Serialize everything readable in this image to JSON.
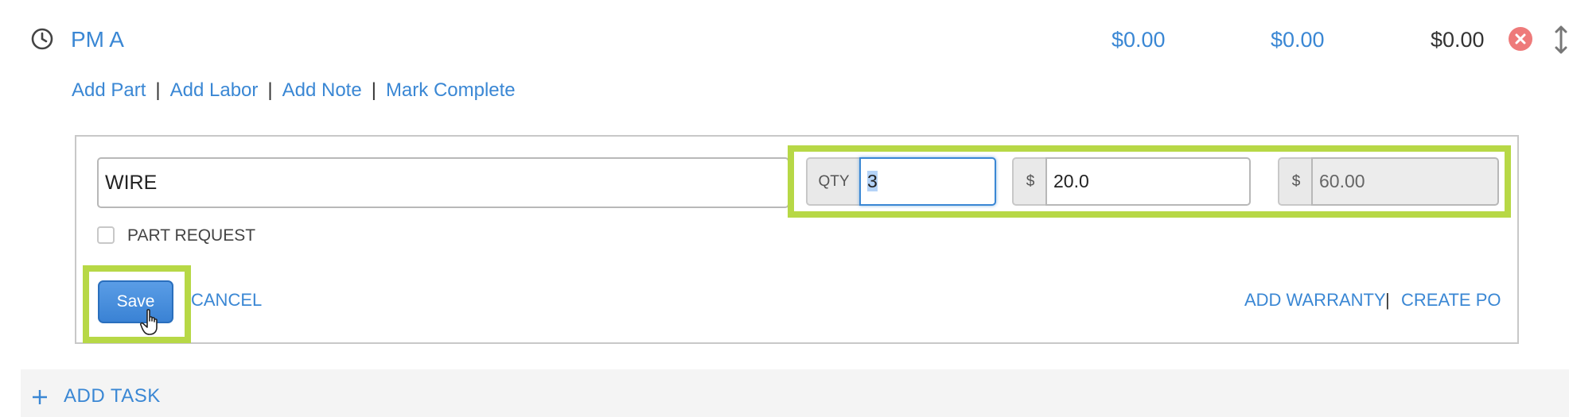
{
  "task": {
    "title": "PM A",
    "parts_total": "$0.00",
    "labor_total": "$0.00",
    "grand_total": "$0.00"
  },
  "actions": {
    "add_part": "Add Part",
    "add_labor": "Add Labor",
    "add_note": "Add Note",
    "mark_complete": "Mark Complete",
    "separator": "|"
  },
  "form": {
    "part_name": "WIRE",
    "qty_label": "QTY",
    "qty_value": "3",
    "price_symbol": "$",
    "price_value": "20.0",
    "total_symbol": "$",
    "total_value": "60.00",
    "part_request_label": "PART REQUEST",
    "save_label": "Save",
    "cancel_label": "CANCEL",
    "add_warranty_label": "ADD WARRANTY",
    "footer_separator": "|",
    "create_po_label": "CREATE PO"
  },
  "add_task": {
    "label": "ADD TASK"
  },
  "colors": {
    "link": "#3a87d4",
    "highlight": "#b7d846",
    "remove": "#ee7a7a"
  },
  "icons": [
    "clock-icon",
    "remove-icon",
    "drag-handle-icon",
    "cursor-hand-icon",
    "plus-icon"
  ]
}
